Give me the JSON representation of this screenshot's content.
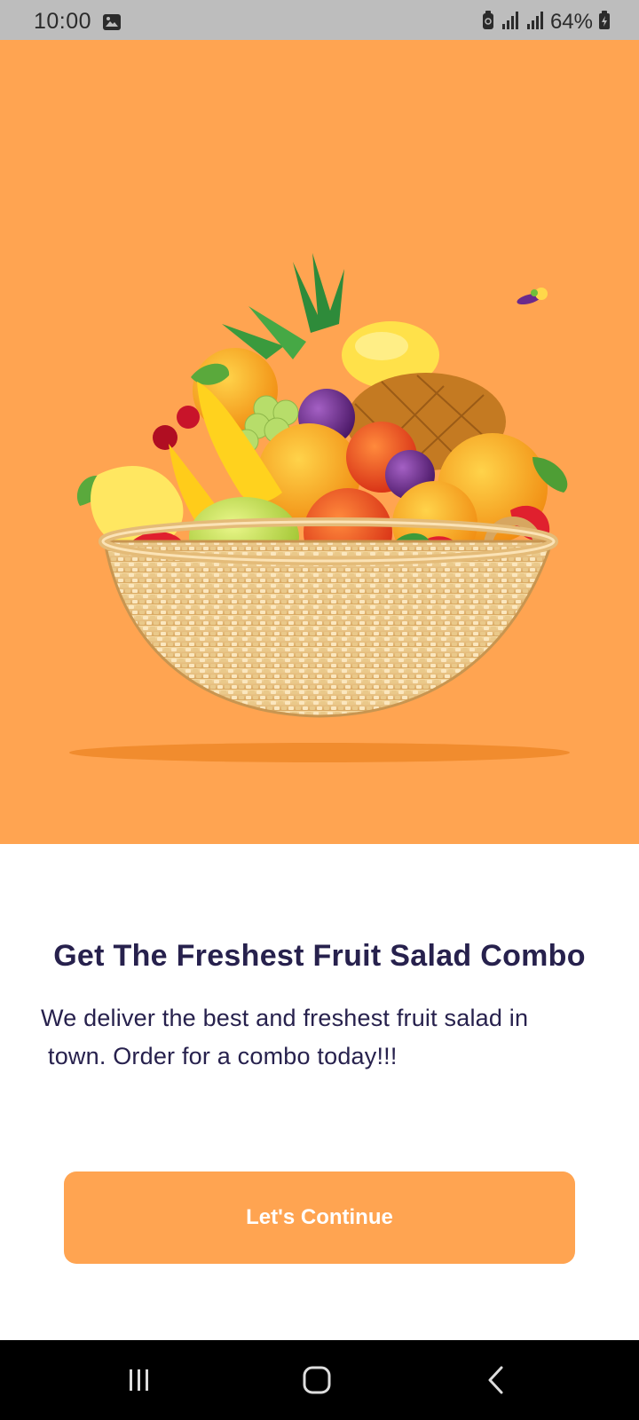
{
  "status_bar": {
    "time": "10:00",
    "battery": "64%",
    "icons": [
      "image-notification-icon",
      "battery-saver-icon",
      "signal-icon",
      "signal-icon",
      "battery-icon"
    ]
  },
  "hero": {
    "background_color": "#ffa451",
    "image": "fruit-basket-illustration"
  },
  "onboarding": {
    "title": "Get The Freshest Fruit Salad Combo",
    "subtitle_line1": "We deliver the best and freshest fruit salad in",
    "subtitle_line2": "town. Order for a combo today!!!"
  },
  "cta": {
    "label": "Let's Continue",
    "color": "#ffa451"
  },
  "nav_bar": {
    "buttons": [
      "recent-apps-icon",
      "home-icon",
      "back-icon"
    ]
  },
  "colors": {
    "text": "#27214d",
    "accent": "#ffa451"
  }
}
